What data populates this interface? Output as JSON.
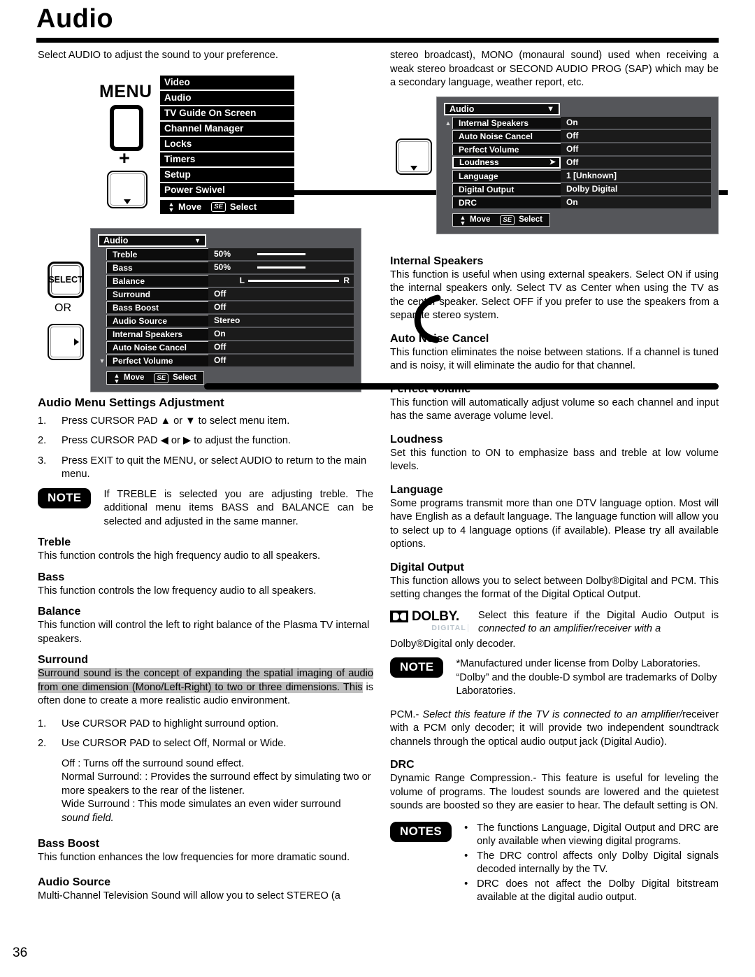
{
  "page": {
    "title": "Audio",
    "number": "36",
    "intro": "Select AUDIO to adjust the sound to your preference."
  },
  "remote": {
    "menu_label": "MENU",
    "plus": "+",
    "select_label": "SELECT",
    "or_label": "OR"
  },
  "main_menu": {
    "items": [
      "Video",
      "Audio",
      "TV Guide On Screen",
      "Channel Manager",
      "Locks",
      "Timers",
      "Setup",
      "Power Swivel"
    ],
    "footer": {
      "move": "Move",
      "select_key": "SE",
      "select": "Select"
    }
  },
  "osd_left": {
    "title": "Audio",
    "chevron": "▼",
    "rows": [
      {
        "label": "Treble",
        "value": "50%",
        "type": "slider",
        "fill": 52
      },
      {
        "label": "Bass",
        "value": "50%",
        "type": "slider",
        "fill": 52
      },
      {
        "label": "Balance",
        "value": "",
        "type": "balance",
        "left": "L",
        "right": "R"
      },
      {
        "label": "Surround",
        "value": "Off",
        "type": "text"
      },
      {
        "label": "Bass Boost",
        "value": "Off",
        "type": "text"
      },
      {
        "label": "Audio Source",
        "value": "Stereo",
        "type": "text"
      },
      {
        "label": "Internal Speakers",
        "value": "On",
        "type": "text"
      },
      {
        "label": "Auto Noise Cancel",
        "value": "Off",
        "type": "text"
      },
      {
        "label": "Perfect Volume",
        "value": "Off",
        "type": "text",
        "scroll": "▼"
      }
    ],
    "footer": {
      "move": "Move",
      "select_key": "SE",
      "select": "Select"
    }
  },
  "osd_right": {
    "title": "Audio",
    "chevron": "▼",
    "rows": [
      {
        "label": "Internal Speakers",
        "value": "On",
        "scroll": "▲"
      },
      {
        "label": "Auto Noise Cancel",
        "value": "Off"
      },
      {
        "label": "Perfect Volume",
        "value": "Off"
      },
      {
        "label": "Loudness",
        "value": "Off",
        "selected": true,
        "arrow": "➤"
      },
      {
        "label": "Language",
        "value": "1 [Unknown]"
      },
      {
        "label": "Digital Output",
        "value": "Dolby Digital"
      },
      {
        "label": "DRC",
        "value": "On"
      }
    ],
    "footer": {
      "move": "Move",
      "select_key": "SE",
      "select": "Select"
    }
  },
  "left_column": {
    "adjust_heading": "Audio Menu Settings Adjustment",
    "steps": [
      {
        "n": "1.",
        "text": "Press CURSOR PAD ▲ or ▼ to select menu item."
      },
      {
        "n": "2.",
        "text": "Press CURSOR PAD  ◀ or ▶ to adjust the function."
      },
      {
        "n": "3.",
        "text": "Press EXIT to quit the MENU, or select AUDIO to return to the main menu."
      }
    ],
    "note_badge": "NOTE",
    "note_text": "If TREBLE is selected you are adjusting treble. The additional menu items BASS and BALANCE can be selected and adjusted in the same manner.",
    "sections": [
      {
        "heading": "Treble",
        "body": "This function controls the high frequency audio to all speakers."
      },
      {
        "heading": "Bass",
        "body": "This function controls the low frequency audio to all speakers."
      },
      {
        "heading": "Balance",
        "body": "This function will control the left to right balance of the Plasma TV internal speakers."
      }
    ],
    "surround": {
      "heading": "Surround",
      "highlighted": "Surround sound is the concept of expanding the spatial imaging of audio from one dimension (Mono/Left-Right) to two or three dimensions. This",
      "rest": " is often done to create a more realistic audio environment.",
      "steps": [
        {
          "n": "1.",
          "text": "Use CURSOR PAD to highlight surround option."
        },
        {
          "n": "2.",
          "text": "Use CURSOR PAD to select Off, Normal or Wide."
        }
      ],
      "options": [
        "Off : Turns off the surround sound effect.",
        "Normal Surround:   : Provides the surround effect by simulating two or more speakers to the rear of the listener.",
        "Wide Surround   : This mode simulates an even wider surround "
      ],
      "options_italic_tail": "sound field."
    },
    "bass_boost": {
      "heading": "Bass Boost",
      "body": "This function enhances the low frequencies for more dramatic sound."
    },
    "audio_source": {
      "heading": "Audio Source",
      "body": "Multi-Channel Television Sound will allow you to select STEREO (a"
    }
  },
  "right_column": {
    "intro_continued": "stereo broadcast), MONO (monaural sound) used when receiving a weak stereo broadcast or SECOND AUDIO PROG (SAP) which may be a secondary language, weather report, etc.",
    "sections": [
      {
        "heading": "Internal Speakers",
        "body": "This function is useful when using external speakers. Select ON if using the internal speakers only. Select TV as Center when using the TV as the center speaker. Select OFF if you prefer to use the speakers from a separate stereo system."
      },
      {
        "heading": "Auto Noise Cancel",
        "body": "This function eliminates the noise between stations. If a channel is tuned and is noisy, it will eliminate the audio for that channel."
      },
      {
        "heading": "Perfect Volume",
        "body": "This function will automatically adjust volume so each channel and input has the same average volume level."
      },
      {
        "heading": "Loudness",
        "body": "Set this function to ON to emphasize bass and treble at low volume levels."
      },
      {
        "heading": "Language",
        "body": "Some programs transmit more than one DTV language option. Most will have English as a default language. The language function will allow you to select up to 4 language options (if available). Please try all available options."
      },
      {
        "heading": "Digital Output",
        "body": "This function allows you to select between Dolby®Digital and PCM. This setting changes the format of the Digital Optical Output."
      }
    ],
    "dolby": {
      "word": "DOLBY.",
      "sub": "DIGITAL",
      "text_normal": "Select this feature if the Digital Audio Output is ",
      "text_italic": "connected to an amplifier/receiver with a",
      "text_tail": "Dolby®Digital only decoder."
    },
    "note_badge": "NOTE",
    "note_text": "*Manufactured under license from Dolby Laboratories. “Dolby” and the double-D symbol are trademarks of Dolby Laboratories.",
    "pcm": "PCM.- ",
    "pcm_italic": "Select this feature if the TV is connected to an amplifier/",
    "pcm_rest": "receiver with a PCM only decoder; it will provide two independent soundtrack channels through the optical audio output jack (Digital Audio).",
    "drc": {
      "heading": "DRC",
      "body": "Dynamic Range Compression.- This feature is useful for leveling the volume of programs. The loudest sounds are lowered and the quietest sounds are boosted so they are easier to hear. The default setting is ON."
    },
    "notes_badge": "NOTES",
    "notes_bullets": [
      "The functions Language, Digital Output and DRC are only available when viewing digital programs.",
      "The DRC control affects only Dolby   Digital signals decoded internally by the TV.",
      "DRC does not affect the Dolby   Digital bitstream available at the digital audio output."
    ]
  }
}
